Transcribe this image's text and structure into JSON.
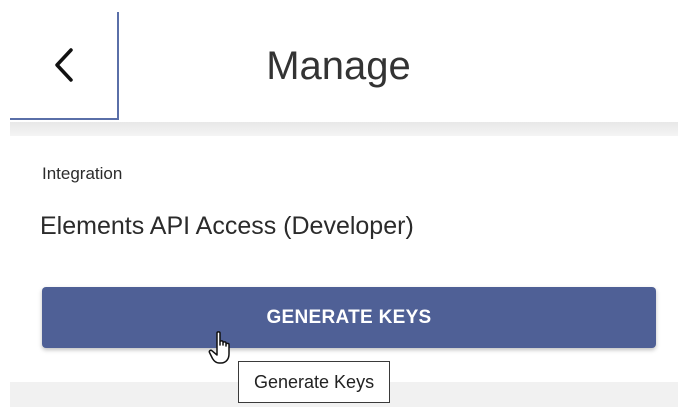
{
  "header": {
    "back_icon": "chevron-left-icon",
    "title": "Manage"
  },
  "integration": {
    "label": "Integration",
    "value": "Elements API Access (Developer)"
  },
  "generate_button": {
    "label": "GENERATE KEYS"
  },
  "tooltip": {
    "text": "Generate Keys"
  },
  "cursor": {
    "icon": "hand-pointer-icon"
  },
  "colors": {
    "accent": "#4f6096",
    "header_border": "#5a6fa8",
    "text": "#2b2b2b"
  }
}
